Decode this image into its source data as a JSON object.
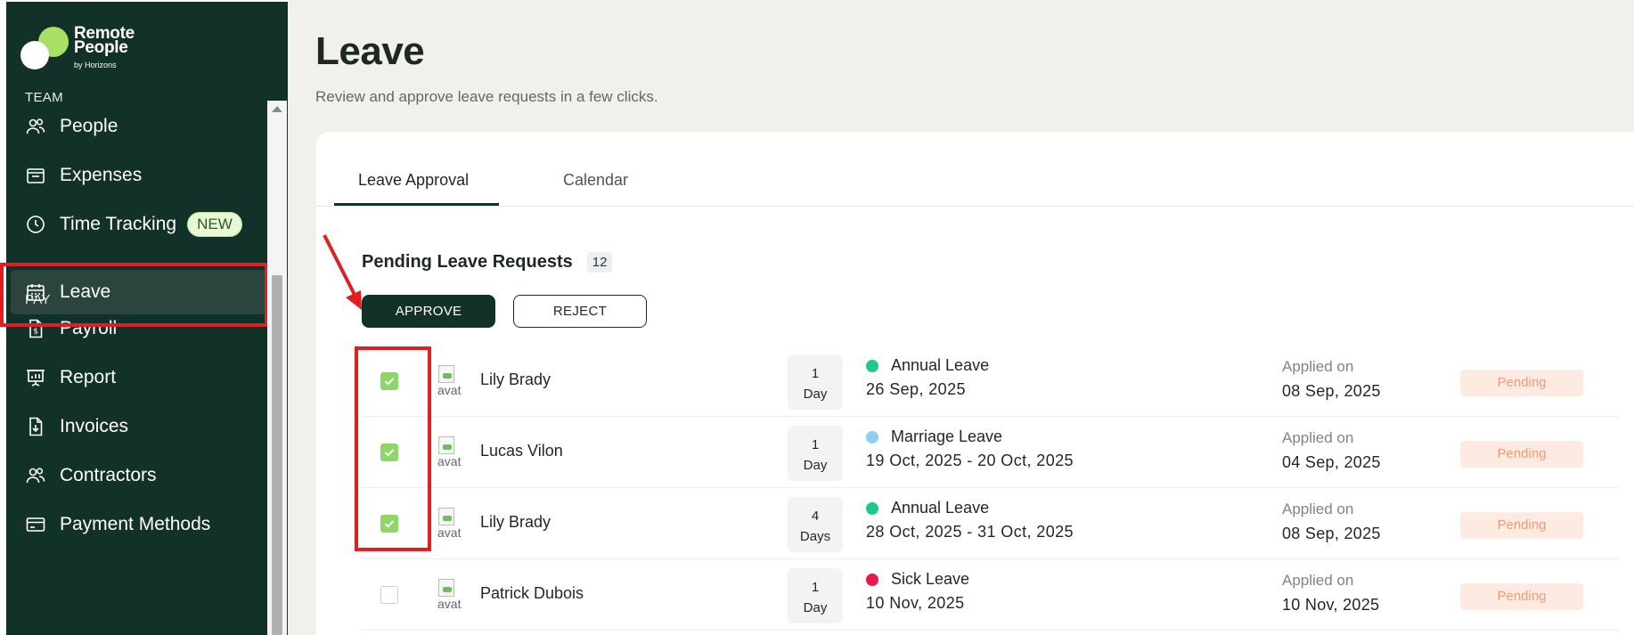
{
  "brand": {
    "line1": "Remote",
    "line2": "People",
    "tagline": "by Horizons"
  },
  "sidebar": {
    "sections": [
      {
        "label": "TEAM"
      },
      {
        "label": "PAY"
      }
    ],
    "team_items": [
      {
        "label": "People",
        "icon": "people-icon"
      },
      {
        "label": "Expenses",
        "icon": "expenses-icon"
      },
      {
        "label": "Time Tracking",
        "icon": "clock-icon",
        "badge": "NEW"
      },
      {
        "label": "Leave",
        "icon": "calendar-icon",
        "active": true
      }
    ],
    "pay_items": [
      {
        "label": "Payroll",
        "icon": "payroll-icon"
      },
      {
        "label": "Report",
        "icon": "report-icon"
      },
      {
        "label": "Invoices",
        "icon": "invoice-icon"
      },
      {
        "label": "Contractors",
        "icon": "contractors-icon"
      },
      {
        "label": "Payment Methods",
        "icon": "credit-card-icon"
      }
    ]
  },
  "page": {
    "title": "Leave",
    "subtitle": "Review and approve leave requests in a few clicks."
  },
  "tabs": [
    {
      "label": "Leave Approval",
      "active": true
    },
    {
      "label": "Calendar",
      "active": false
    }
  ],
  "pending": {
    "title": "Pending Leave Requests",
    "count": "12",
    "approve_label": "APPROVE",
    "reject_label": "REJECT"
  },
  "requests": [
    {
      "checked": true,
      "avatar_alt": "avat",
      "name": "Lily Brady",
      "days_num": "1",
      "days_unit": "Day",
      "leave_type": "Annual Leave",
      "dot_color": "#1fc98a",
      "dates": "26 Sep, 2025",
      "applied_label": "Applied on",
      "applied_date": "08 Sep, 2025",
      "status": "Pending"
    },
    {
      "checked": true,
      "avatar_alt": "avat",
      "name": "Lucas Vilon",
      "days_num": "1",
      "days_unit": "Day",
      "leave_type": "Marriage Leave",
      "dot_color": "#8ecff5",
      "dates": "19 Oct, 2025 - 20 Oct, 2025",
      "applied_label": "Applied on",
      "applied_date": "04 Sep, 2025",
      "status": "Pending"
    },
    {
      "checked": true,
      "avatar_alt": "avat",
      "name": "Lily Brady",
      "days_num": "4",
      "days_unit": "Days",
      "leave_type": "Annual Leave",
      "dot_color": "#1fc98a",
      "dates": "28 Oct, 2025 - 31 Oct, 2025",
      "applied_label": "Applied on",
      "applied_date": "08 Sep, 2025",
      "status": "Pending"
    },
    {
      "checked": false,
      "avatar_alt": "avat",
      "name": "Patrick Dubois",
      "days_num": "1",
      "days_unit": "Day",
      "leave_type": "Sick Leave",
      "dot_color": "#e8194b",
      "dates": "10 Nov, 2025",
      "applied_label": "Applied on",
      "applied_date": "10 Nov, 2025",
      "status": "Pending"
    }
  ],
  "colors": {
    "sidebar_bg": "#123128",
    "accent": "#123128",
    "highlight": "#e02020",
    "checkbox_on": "#8fd66a",
    "pending_bg": "#fdebe2",
    "pending_text": "#f39a74"
  }
}
